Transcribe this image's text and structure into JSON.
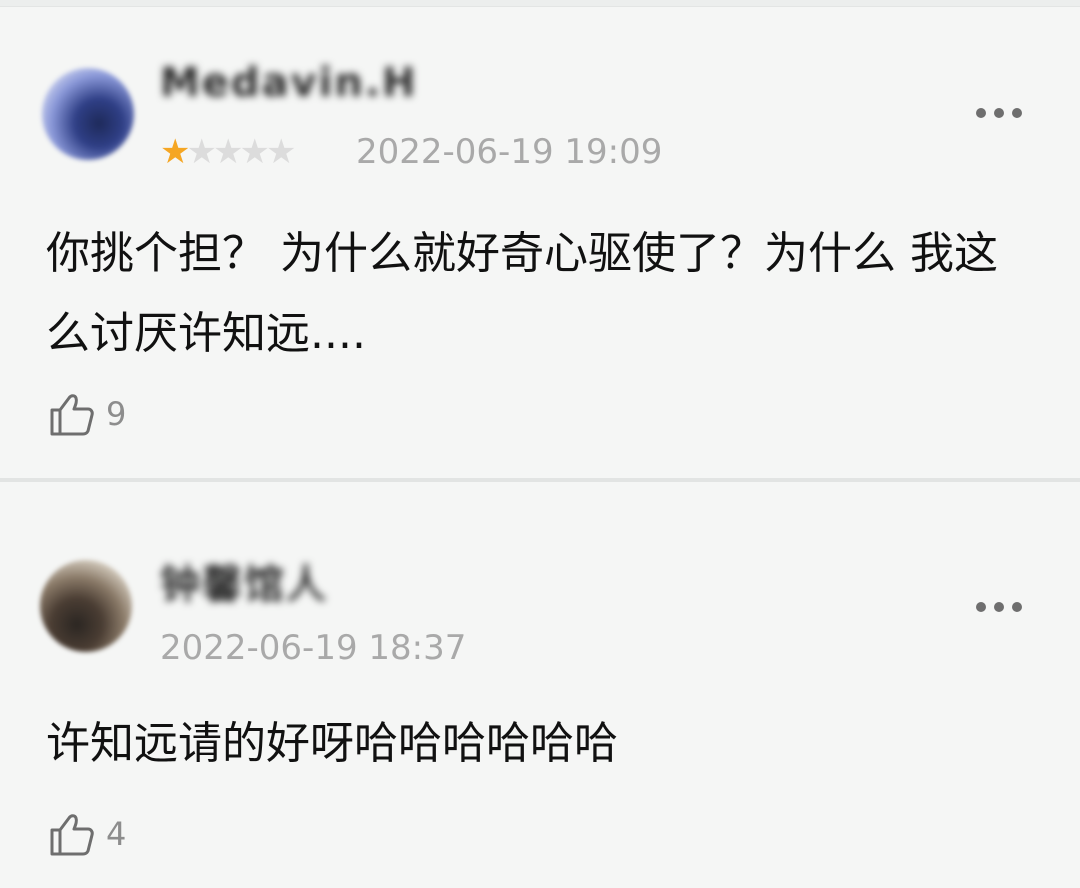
{
  "comments": [
    {
      "username": "Medavin.H",
      "rating": 1,
      "rating_max": 5,
      "timestamp": "2022-06-19 19:09",
      "text": "你挑个担？ 为什么就好奇心驱使了？为什么 我这么讨厌许知远....",
      "likes": "9",
      "avatar_icon": "user-avatar-blurred",
      "more_icon": "more-horizontal-icon",
      "like_icon": "thumbs-up-icon"
    },
    {
      "username": "钟馨馆人",
      "timestamp": "2022-06-19 18:37",
      "text": "许知远请的好呀哈哈哈哈哈哈",
      "likes": "4",
      "avatar_icon": "user-avatar-blurred",
      "more_icon": "more-horizontal-icon",
      "like_icon": "thumbs-up-icon"
    }
  ],
  "colors": {
    "background": "#f5f6f5",
    "star_filled": "#f5a623",
    "star_empty": "#dcdcdc",
    "timestamp": "#a9a9a9",
    "like_count": "#8d8d8d",
    "text": "#111111"
  }
}
